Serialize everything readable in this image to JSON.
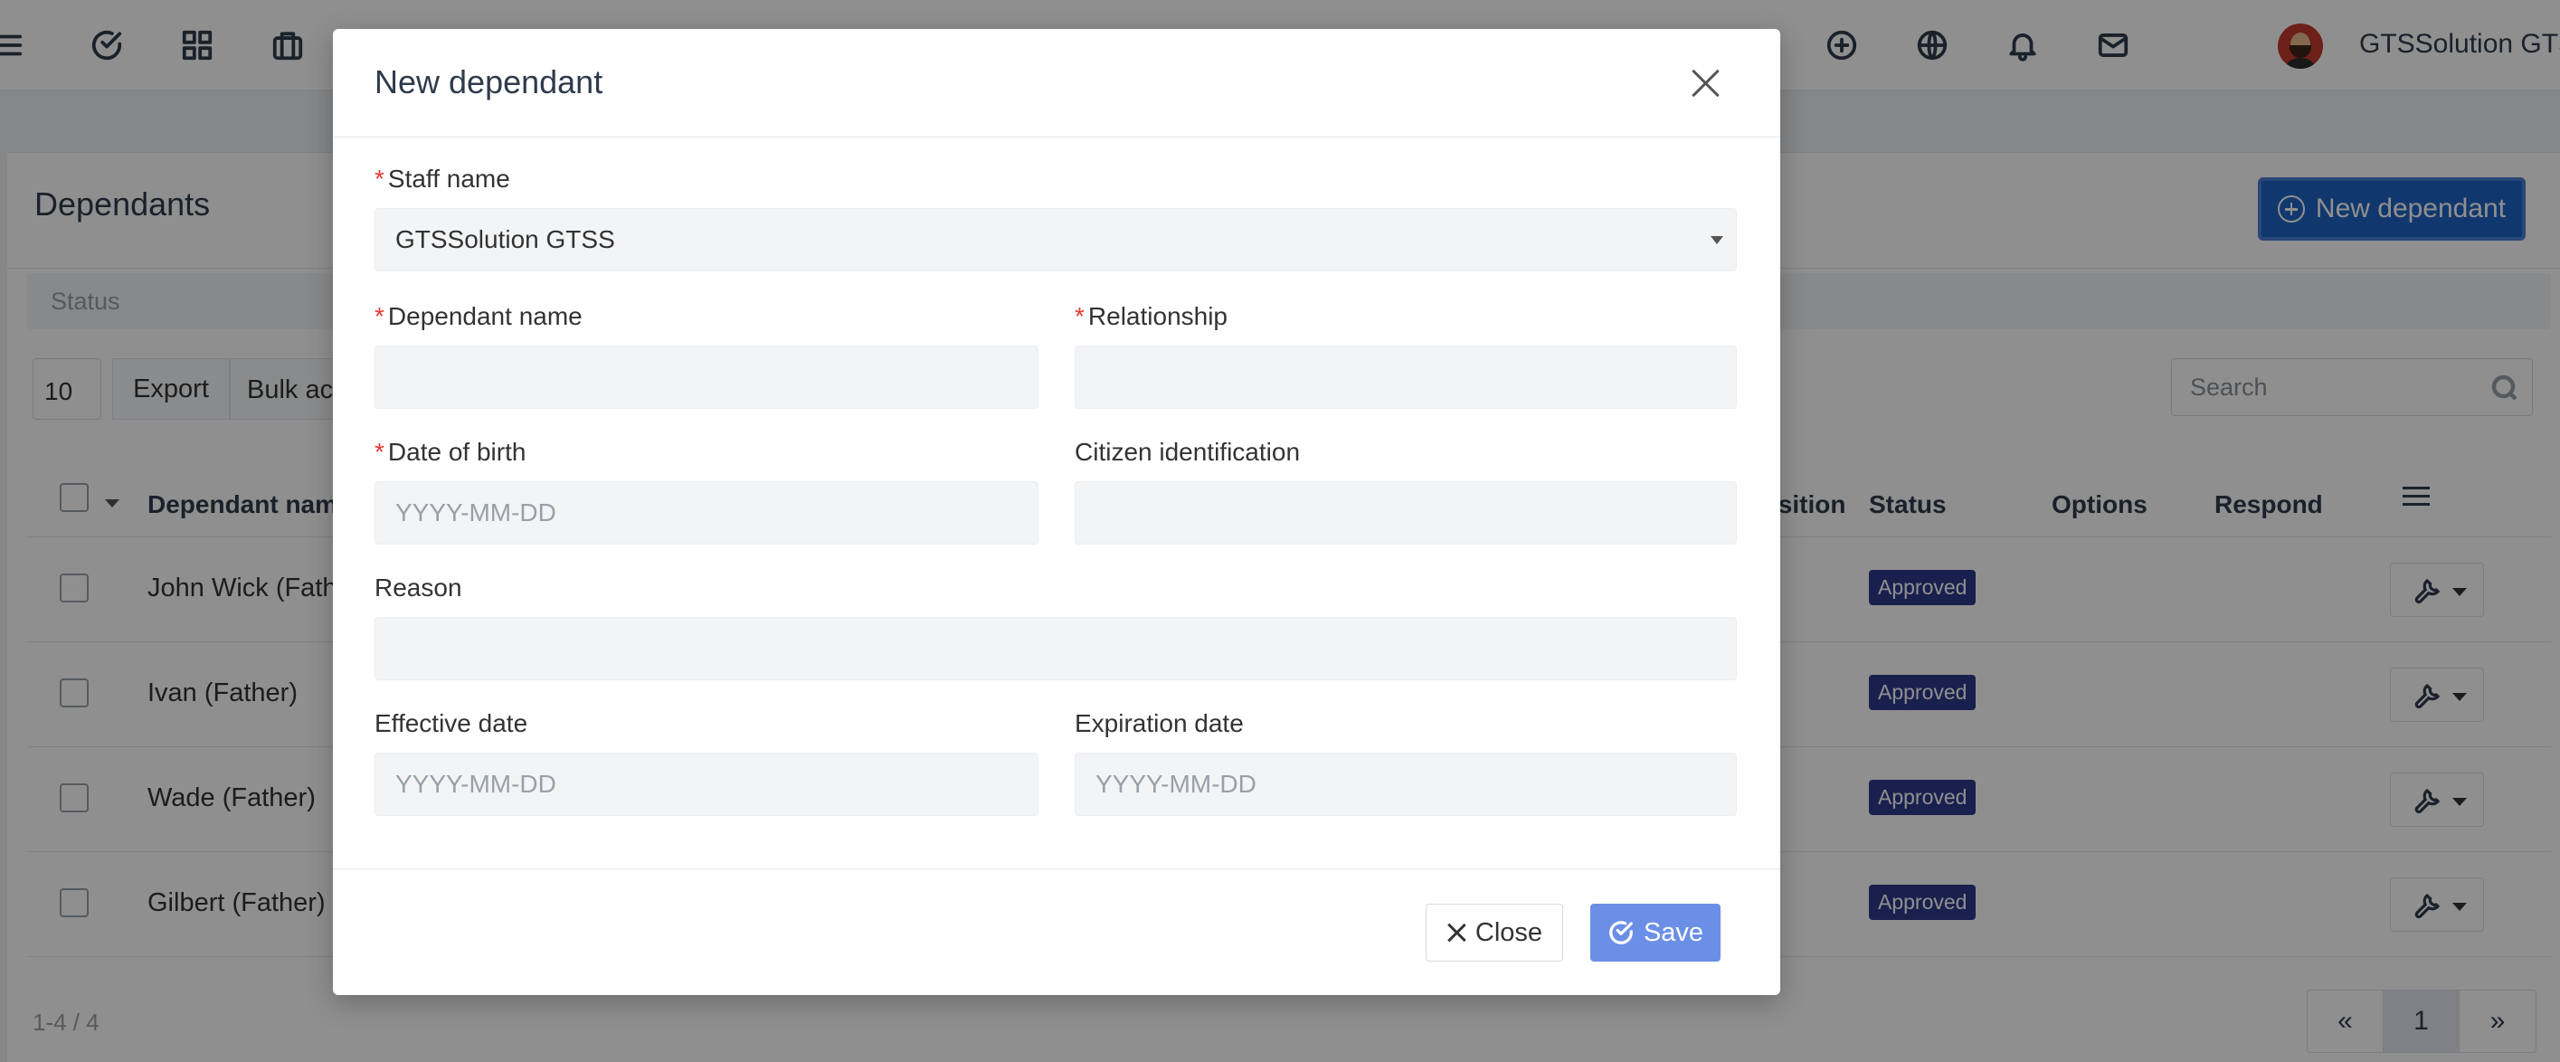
{
  "topbar": {
    "icons": [
      "menu-icon",
      "check-circle-icon",
      "apps-grid-icon",
      "briefcase-icon",
      "search-icon",
      "add-circle-icon",
      "globe-icon",
      "bell-icon",
      "mail-icon"
    ],
    "user_name": "GTSSolution GTSS"
  },
  "page": {
    "title": "Dependants",
    "new_button_label": "New dependant",
    "status_filter_placeholder": "Status",
    "page_length": "10",
    "export_label": "Export",
    "bulk_label": "Bulk actions",
    "search_placeholder": "Search",
    "columns": {
      "name": "Dependant name",
      "position": "Position",
      "status": "Status",
      "options": "Options",
      "respond": "Respond"
    },
    "rows": [
      {
        "name": "John Wick (Father)",
        "status": "Approved"
      },
      {
        "name": "Ivan (Father)",
        "status": "Approved"
      },
      {
        "name": "Wade (Father)",
        "status": "Approved"
      },
      {
        "name": "Gilbert (Father)",
        "status": "Approved"
      }
    ],
    "pagination": {
      "info": "1-4 / 4",
      "first": "«",
      "current": "1",
      "last": "»"
    }
  },
  "modal": {
    "title": "New dependant",
    "required_mark": "*",
    "staff_name_label": "Staff name",
    "staff_name_value": "GTSSolution GTSS",
    "dependant_name_label": "Dependant name",
    "dependant_name_value": "",
    "relationship_label": "Relationship",
    "relationship_value": "",
    "dob_label": "Date of birth",
    "dob_placeholder": "YYYY-MM-DD",
    "citizen_id_label": "Citizen identification",
    "citizen_id_value": "",
    "reason_label": "Reason",
    "reason_value": "",
    "effective_date_label": "Effective date",
    "effective_date_placeholder": "YYYY-MM-DD",
    "expiration_date_label": "Expiration date",
    "expiration_date_placeholder": "YYYY-MM-DD",
    "close_label": "Close",
    "save_label": "Save"
  },
  "colors": {
    "primary": "#1f64c4",
    "save_button": "#6b8fe6",
    "badge_approved": "#2e3a8c",
    "required": "#e53935"
  }
}
